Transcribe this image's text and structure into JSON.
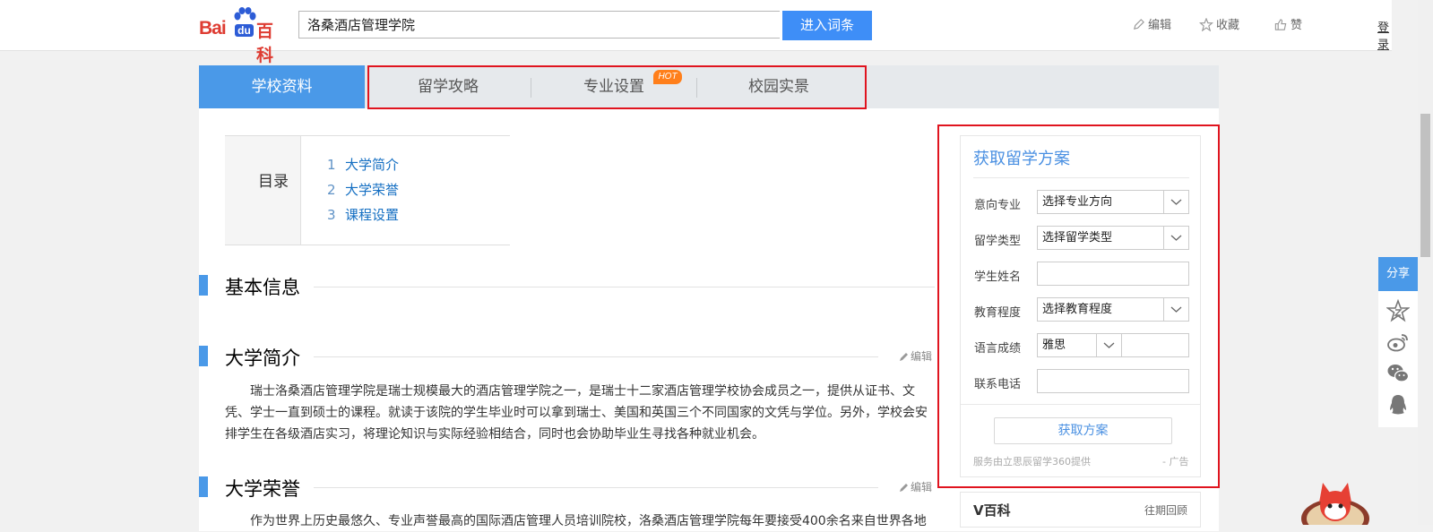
{
  "header": {
    "logo": {
      "bai": "Bai",
      "du": "du",
      "baike": "百科"
    },
    "search_value": "洛桑酒店管理学院",
    "search_button": "进入词条",
    "tools": {
      "edit": "编辑",
      "collect": "收藏",
      "like": "赞"
    },
    "login": "登录"
  },
  "tabs": {
    "active": "学校资料",
    "items": [
      "留学攻略",
      "专业设置",
      "校园实景"
    ],
    "hot": "HOT"
  },
  "toc": {
    "label": "目录",
    "items": [
      {
        "num": "1",
        "label": "大学简介"
      },
      {
        "num": "2",
        "label": "大学荣誉"
      },
      {
        "num": "3",
        "label": "课程设置"
      }
    ]
  },
  "sections": {
    "basic_info": "基本信息",
    "intro": {
      "title": "大学简介",
      "edit": "编辑",
      "text": "瑞士洛桑酒店管理学院是瑞士规模最大的酒店管理学院之一，是瑞士十二家酒店管理学校协会成员之一，提供从证书、文凭、学士一直到硕士的课程。就读于该院的学生毕业时可以拿到瑞士、美国和英国三个不同国家的文凭与学位。另外，学校会安排学生在各级酒店实习，将理论知识与实际经验相结合，同时也会协助毕业生寻找各种就业机会。"
    },
    "honor": {
      "title": "大学荣誉",
      "edit": "编辑",
      "text": "作为世界上历史最悠久、专业声誉最高的国际酒店管理人员培训院校，洛桑酒店管理学院每年要接受400余名来自世界各地"
    }
  },
  "form": {
    "title": "获取留学方案",
    "fields": {
      "major_label": "意向专业",
      "major_value": "选择专业方向",
      "type_label": "留学类型",
      "type_value": "选择留学类型",
      "name_label": "学生姓名",
      "name_value": "",
      "edu_label": "教育程度",
      "edu_value": "选择教育程度",
      "lang_label": "语言成绩",
      "lang_value": "雅思",
      "lang_score": "",
      "phone_label": "联系电话",
      "phone_value": ""
    },
    "submit": "获取方案",
    "note": "服务由立思辰留学360提供",
    "ad": "- 广告"
  },
  "vbaike": {
    "title": "V百科",
    "more": "往期回顾"
  },
  "share": {
    "label": "分享"
  },
  "colors": {
    "accent": "#4a99e8",
    "highlight": "#e0141f",
    "hot": "#ff7f1b",
    "link": "#136ec2"
  }
}
